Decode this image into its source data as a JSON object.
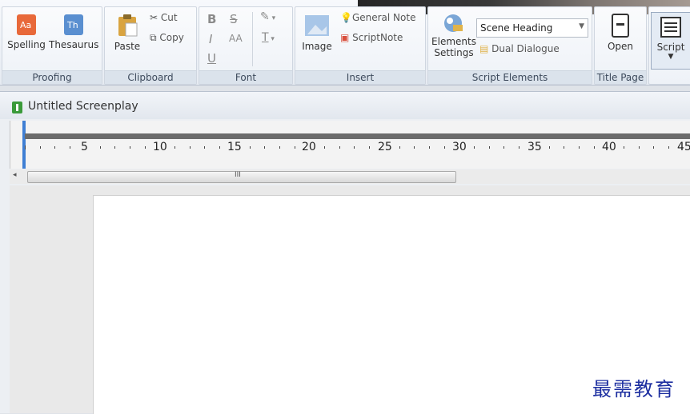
{
  "ribbon": {
    "proofing": {
      "label": "Proofing",
      "spelling": "Spelling",
      "thesaurus": "Thesaurus"
    },
    "clipboard": {
      "label": "Clipboard",
      "paste": "Paste",
      "cut": "Cut",
      "copy": "Copy"
    },
    "font": {
      "label": "Font",
      "bold": "B",
      "strike": "S",
      "italic": "I",
      "size": "AA",
      "underline": "U",
      "textcolor": "T"
    },
    "insert": {
      "label": "Insert",
      "image": "Image",
      "general_note": "General Note",
      "script_note": "ScriptNote"
    },
    "script_elements": {
      "label": "Script Elements",
      "elements_settings_1": "Elements",
      "elements_settings_2": "Settings",
      "element_select": "Scene Heading",
      "dual_dialogue": "Dual Dialogue"
    },
    "title_page": {
      "label": "Title Page",
      "open": "Open"
    },
    "script": {
      "label": "Script"
    }
  },
  "document": {
    "title": "Untitled Screenplay"
  },
  "ruler": {
    "numbers": [
      "5",
      "10",
      "15",
      "20",
      "25",
      "30",
      "35",
      "40",
      "45"
    ]
  },
  "scroll": {
    "grip": "III"
  },
  "watermark": "最需教育"
}
